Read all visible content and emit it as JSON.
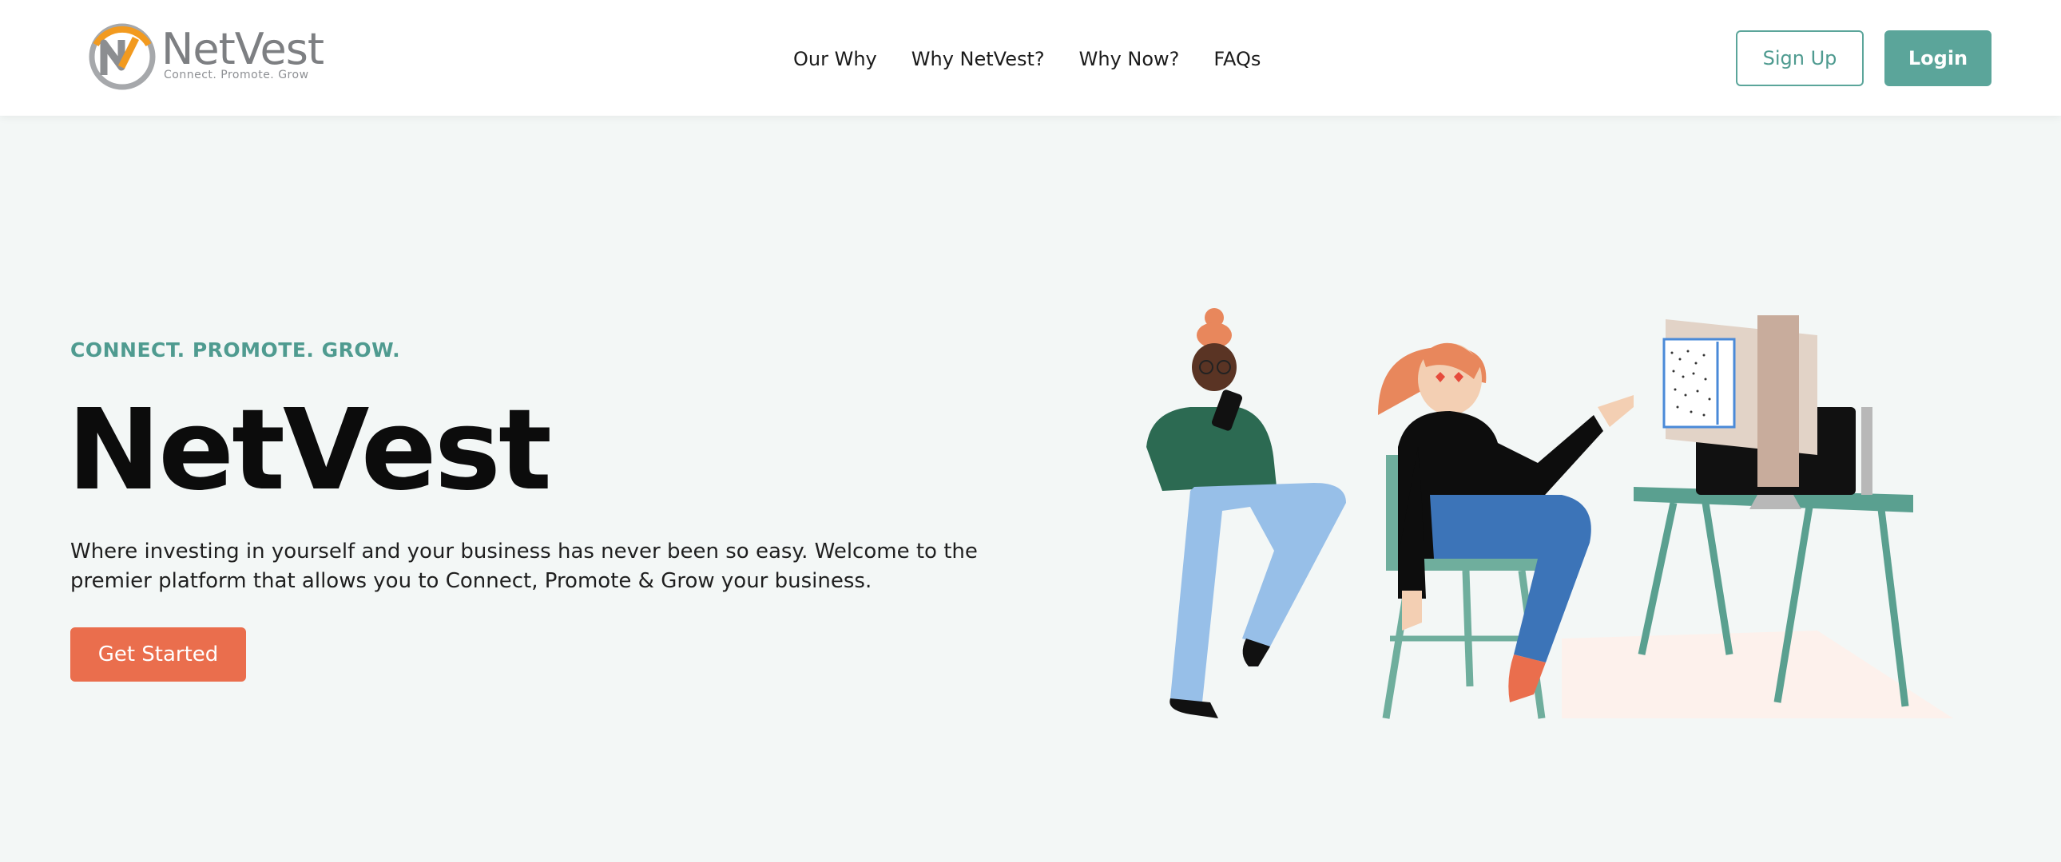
{
  "header": {
    "logo": {
      "name": "NetVest",
      "tagline": "Connect. Promote. Grow"
    },
    "nav": [
      {
        "label": "Our Why"
      },
      {
        "label": "Why NetVest?"
      },
      {
        "label": "Why Now?"
      },
      {
        "label": "FAQs"
      }
    ],
    "signup_label": "Sign Up",
    "login_label": "Login"
  },
  "hero": {
    "eyebrow": "CONNECT. PROMOTE. GROW.",
    "title": "NetVest",
    "description": "Where investing in yourself and your business has never been so easy. Welcome to the premier platform that allows you to Connect, Promote & Grow your business.",
    "cta_label": "Get Started"
  },
  "colors": {
    "accent_teal": "#5ba59a",
    "cta_orange": "#ea6e4d",
    "page_background": "#f3f7f6"
  }
}
